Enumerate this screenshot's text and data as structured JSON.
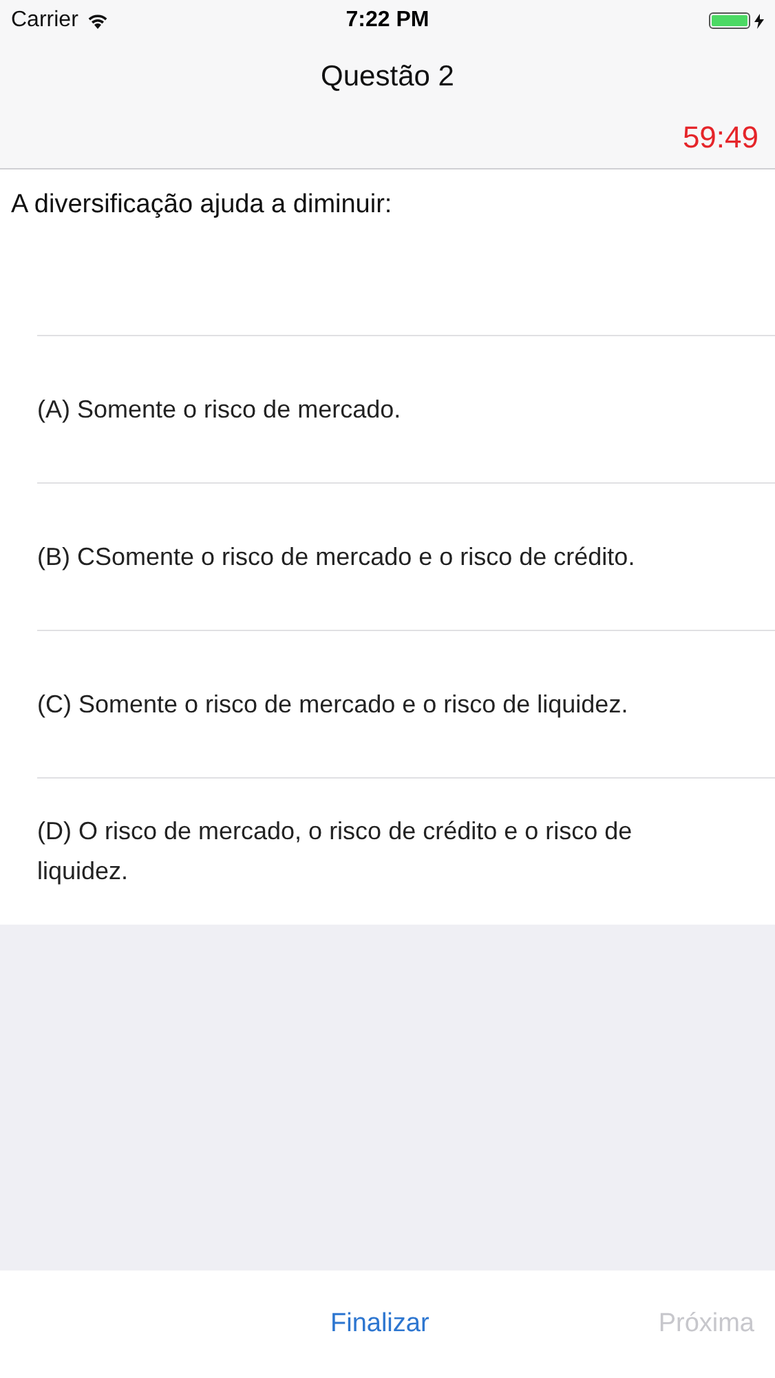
{
  "status_bar": {
    "carrier": "Carrier",
    "time": "7:22 PM"
  },
  "navigation": {
    "title": "Questão 2",
    "timer": "59:49"
  },
  "question": {
    "text": "A diversificação ajuda a diminuir:"
  },
  "options": [
    {
      "text": "(A) Somente o risco de mercado.",
      "selected": false
    },
    {
      "text": "(B) CSomente o risco de mercado e o risco de crédito.",
      "selected": false
    },
    {
      "text": "(C) Somente o risco de mercado e o risco de liquidez.",
      "selected": false
    },
    {
      "text": "(D) O risco de mercado, o risco de crédito e o risco de liquidez.",
      "selected": false
    }
  ],
  "toolbar": [
    {
      "label": "Finalizar",
      "disabled": false
    },
    {
      "label": "Próxima",
      "disabled": true
    }
  ]
}
